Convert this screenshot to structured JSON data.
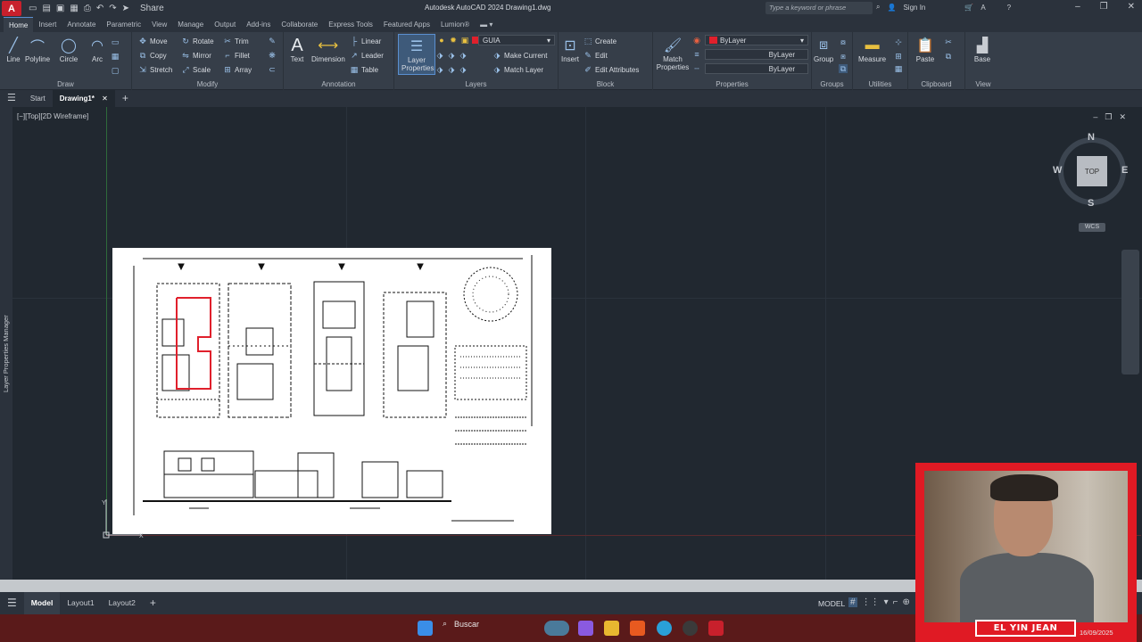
{
  "window": {
    "title": "Autodesk AutoCAD 2024   Drawing1.dwg",
    "app_letter": "A",
    "share_label": "Share",
    "search_placeholder": "Type a keyword or phrase",
    "sign_in": "Sign In"
  },
  "ribbon_tabs": [
    "Home",
    "Insert",
    "Annotate",
    "Parametric",
    "View",
    "Manage",
    "Output",
    "Add-ins",
    "Collaborate",
    "Express Tools",
    "Featured Apps",
    "Lumion®"
  ],
  "ribbon": {
    "draw": {
      "label": "Draw",
      "line": "Line",
      "polyline": "Polyline",
      "circle": "Circle",
      "arc": "Arc"
    },
    "modify": {
      "label": "Modify",
      "move": "Move",
      "rotate": "Rotate",
      "trim": "Trim",
      "copy": "Copy",
      "mirror": "Mirror",
      "fillet": "Fillet",
      "stretch": "Stretch",
      "scale": "Scale",
      "array": "Array"
    },
    "annotation": {
      "label": "Annotation",
      "text": "Text",
      "dimension": "Dimension",
      "linear": "Linear",
      "leader": "Leader",
      "table": "Table"
    },
    "layers": {
      "label": "Layers",
      "layer_properties": "Layer Properties",
      "current_layer": "GUIA",
      "make_current": "Make Current",
      "match_layer": "Match Layer"
    },
    "block": {
      "label": "Block",
      "insert": "Insert",
      "create": "Create",
      "edit": "Edit",
      "edit_attributes": "Edit Attributes"
    },
    "properties": {
      "label": "Properties",
      "match_properties": "Match Properties",
      "color": "ByLayer",
      "linetype": "ByLayer",
      "lineweight": "ByLayer"
    },
    "groups": {
      "label": "Groups",
      "group": "Group"
    },
    "utilities": {
      "label": "Utilities",
      "measure": "Measure"
    },
    "clipboard": {
      "label": "Clipboard",
      "paste": "Paste"
    },
    "view": {
      "label": "View",
      "base": "Base"
    }
  },
  "file_tabs": {
    "start": "Start",
    "drawing": "Drawing1*"
  },
  "viewport": {
    "label": "[−][Top][2D Wireframe]",
    "side_palette": "Layer Properties Manager",
    "viewcube": {
      "n": "N",
      "s": "S",
      "e": "E",
      "w": "W",
      "top": "TOP",
      "wcs": "WCS"
    }
  },
  "layout_tabs": [
    "Model",
    "Layout1",
    "Layout2"
  ],
  "status": {
    "model": "MODEL"
  },
  "taskbar": {
    "search": "Buscar",
    "date": "16/09/2025"
  },
  "webcam": {
    "name": "EL YIN JEAN"
  },
  "colors": {
    "accent_red": "#e01a24",
    "layer_color": "#e0202c"
  }
}
